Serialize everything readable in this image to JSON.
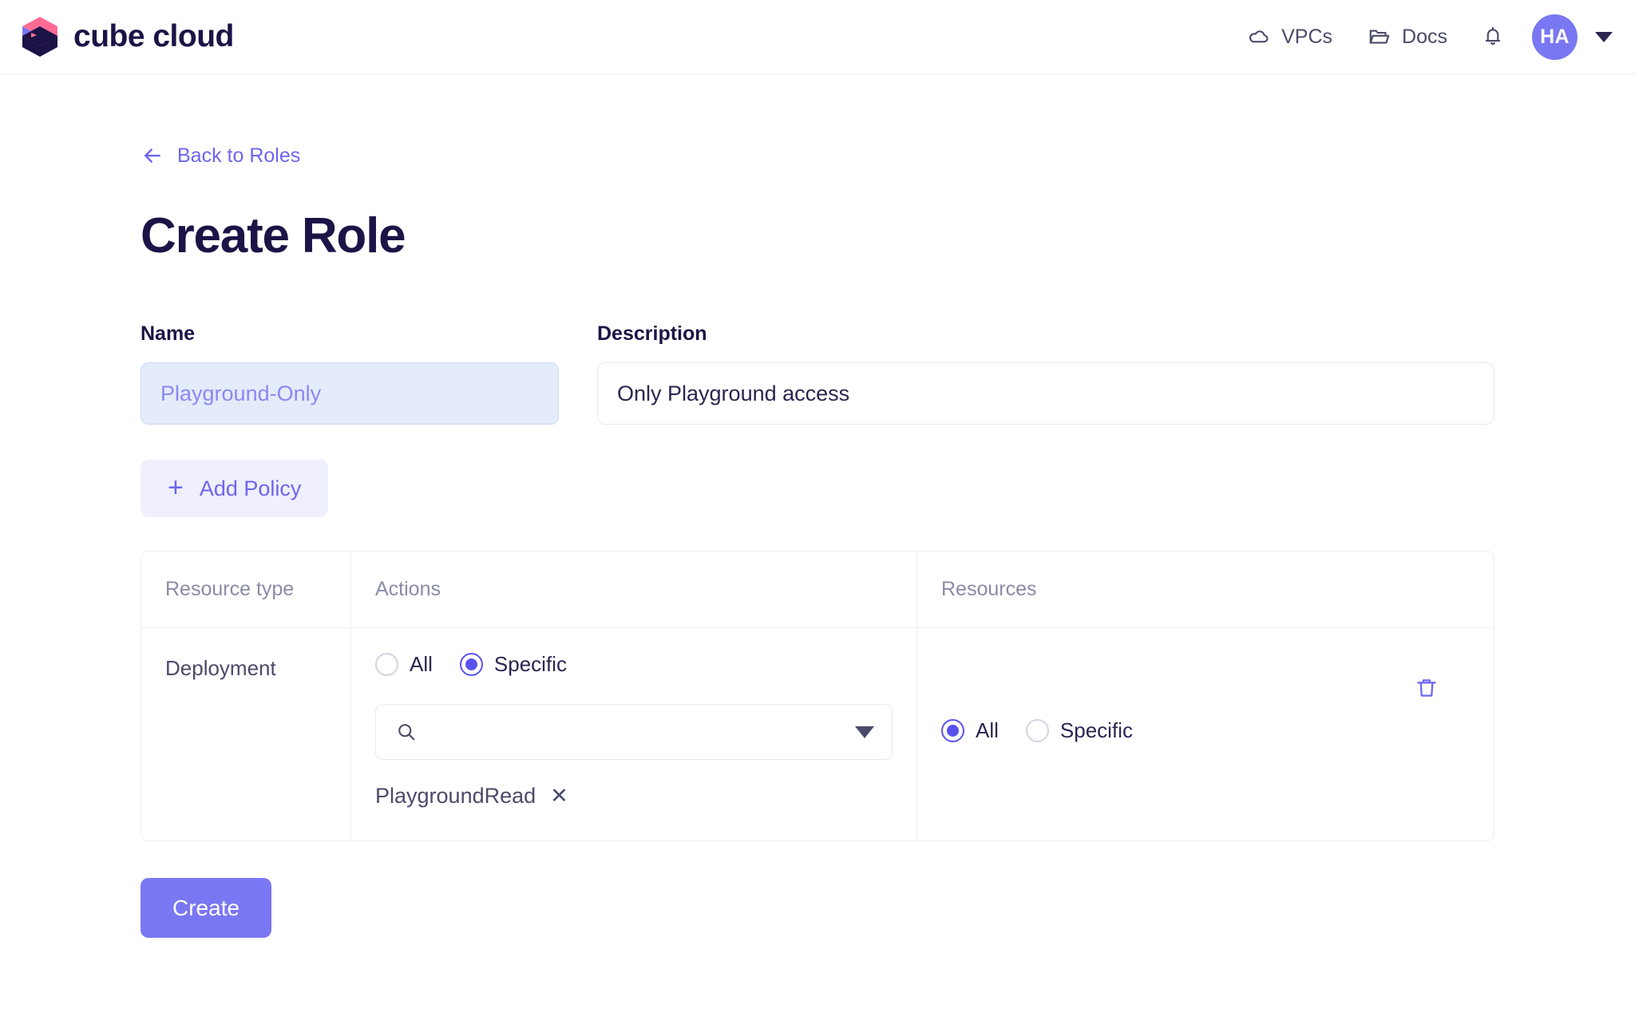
{
  "brand": {
    "name": "cube cloud",
    "logo_colors": {
      "left_face": "#7a77f2",
      "right_face": "#ff6b93",
      "bottom_face": "#1c1346"
    }
  },
  "topnav": {
    "links": [
      {
        "label": "VPCs",
        "icon": "cloud-icon"
      },
      {
        "label": "Docs",
        "icon": "folder-icon"
      }
    ],
    "notifications_icon": "bell-icon",
    "avatar_initials": "HA",
    "avatar_color": "#7a77f2",
    "account_menu_icon": "chevron-down-icon"
  },
  "page": {
    "back_link": "Back to Roles",
    "back_icon": "arrow-left-icon",
    "title": "Create Role"
  },
  "form": {
    "name": {
      "label": "Name",
      "value": "Playground-Only",
      "placeholder": "Name"
    },
    "description": {
      "label": "Description",
      "value": "Only Playground access",
      "placeholder": "Description"
    },
    "add_policy": {
      "label": "Add Policy",
      "icon": "plus-icon"
    }
  },
  "policy_table": {
    "headers": {
      "resource_type": "Resource type",
      "actions": "Actions",
      "resources": "Resources"
    },
    "rows": [
      {
        "resource_type": "Deployment",
        "actions": {
          "options": [
            {
              "label": "All",
              "selected": false
            },
            {
              "label": "Specific",
              "selected": true
            }
          ],
          "search_placeholder": "",
          "search_value": "",
          "search_icon": "search-icon",
          "dropdown_icon": "caret-down-icon",
          "tags": [
            {
              "label": "PlaygroundRead",
              "remove_icon": "close-icon"
            }
          ]
        },
        "resources": {
          "options": [
            {
              "label": "All",
              "selected": true
            },
            {
              "label": "Specific",
              "selected": false
            }
          ]
        },
        "delete_icon": "trash-icon"
      }
    ]
  },
  "footer": {
    "create_label": "Create"
  },
  "colors": {
    "accent_purple": "#7a77f2",
    "link_purple": "#6d66f0",
    "radio_purple": "#5b52ee",
    "dark_navy": "#1c1346",
    "muted": "#8b8ba7",
    "border": "#eceef3",
    "selected_field_bg": "#e4ecfb"
  }
}
